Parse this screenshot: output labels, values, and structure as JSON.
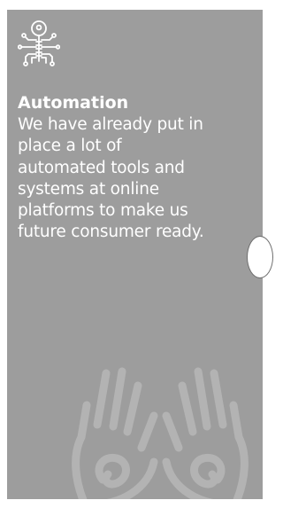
{
  "feature": {
    "icon": "key-circuit-icon",
    "title": "Automation",
    "description_lines": [
      "We have already put in",
      "place a lot of",
      "automated tools and",
      "systems at online",
      "platforms to make us",
      "future consumer ready."
    ]
  },
  "decoration": {
    "icon": "hands-icon"
  },
  "colors": {
    "card_background": "#9d9d9d",
    "text": "#ffffff",
    "watermark": "#b3b3b3"
  }
}
